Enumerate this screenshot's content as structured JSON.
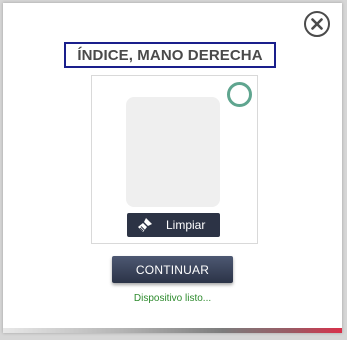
{
  "dialog": {
    "title": "ÍNDICE, MANO DERECHA",
    "close_icon": "close-x-circle-icon",
    "clear_button_label": "Limpiar",
    "clear_button_icon": "broom-icon",
    "continue_button_label": "CONTINUAR",
    "status_message": "Dispositivo listo...",
    "status_ring_icon": "device-status-ring-icon"
  },
  "colors": {
    "title_border": "#1a1f8c",
    "status_ring": "#5fa58f",
    "status_text": "#2e8b2e",
    "button_bg": "#2c3345",
    "accent_bar_end": "#d9304a"
  }
}
